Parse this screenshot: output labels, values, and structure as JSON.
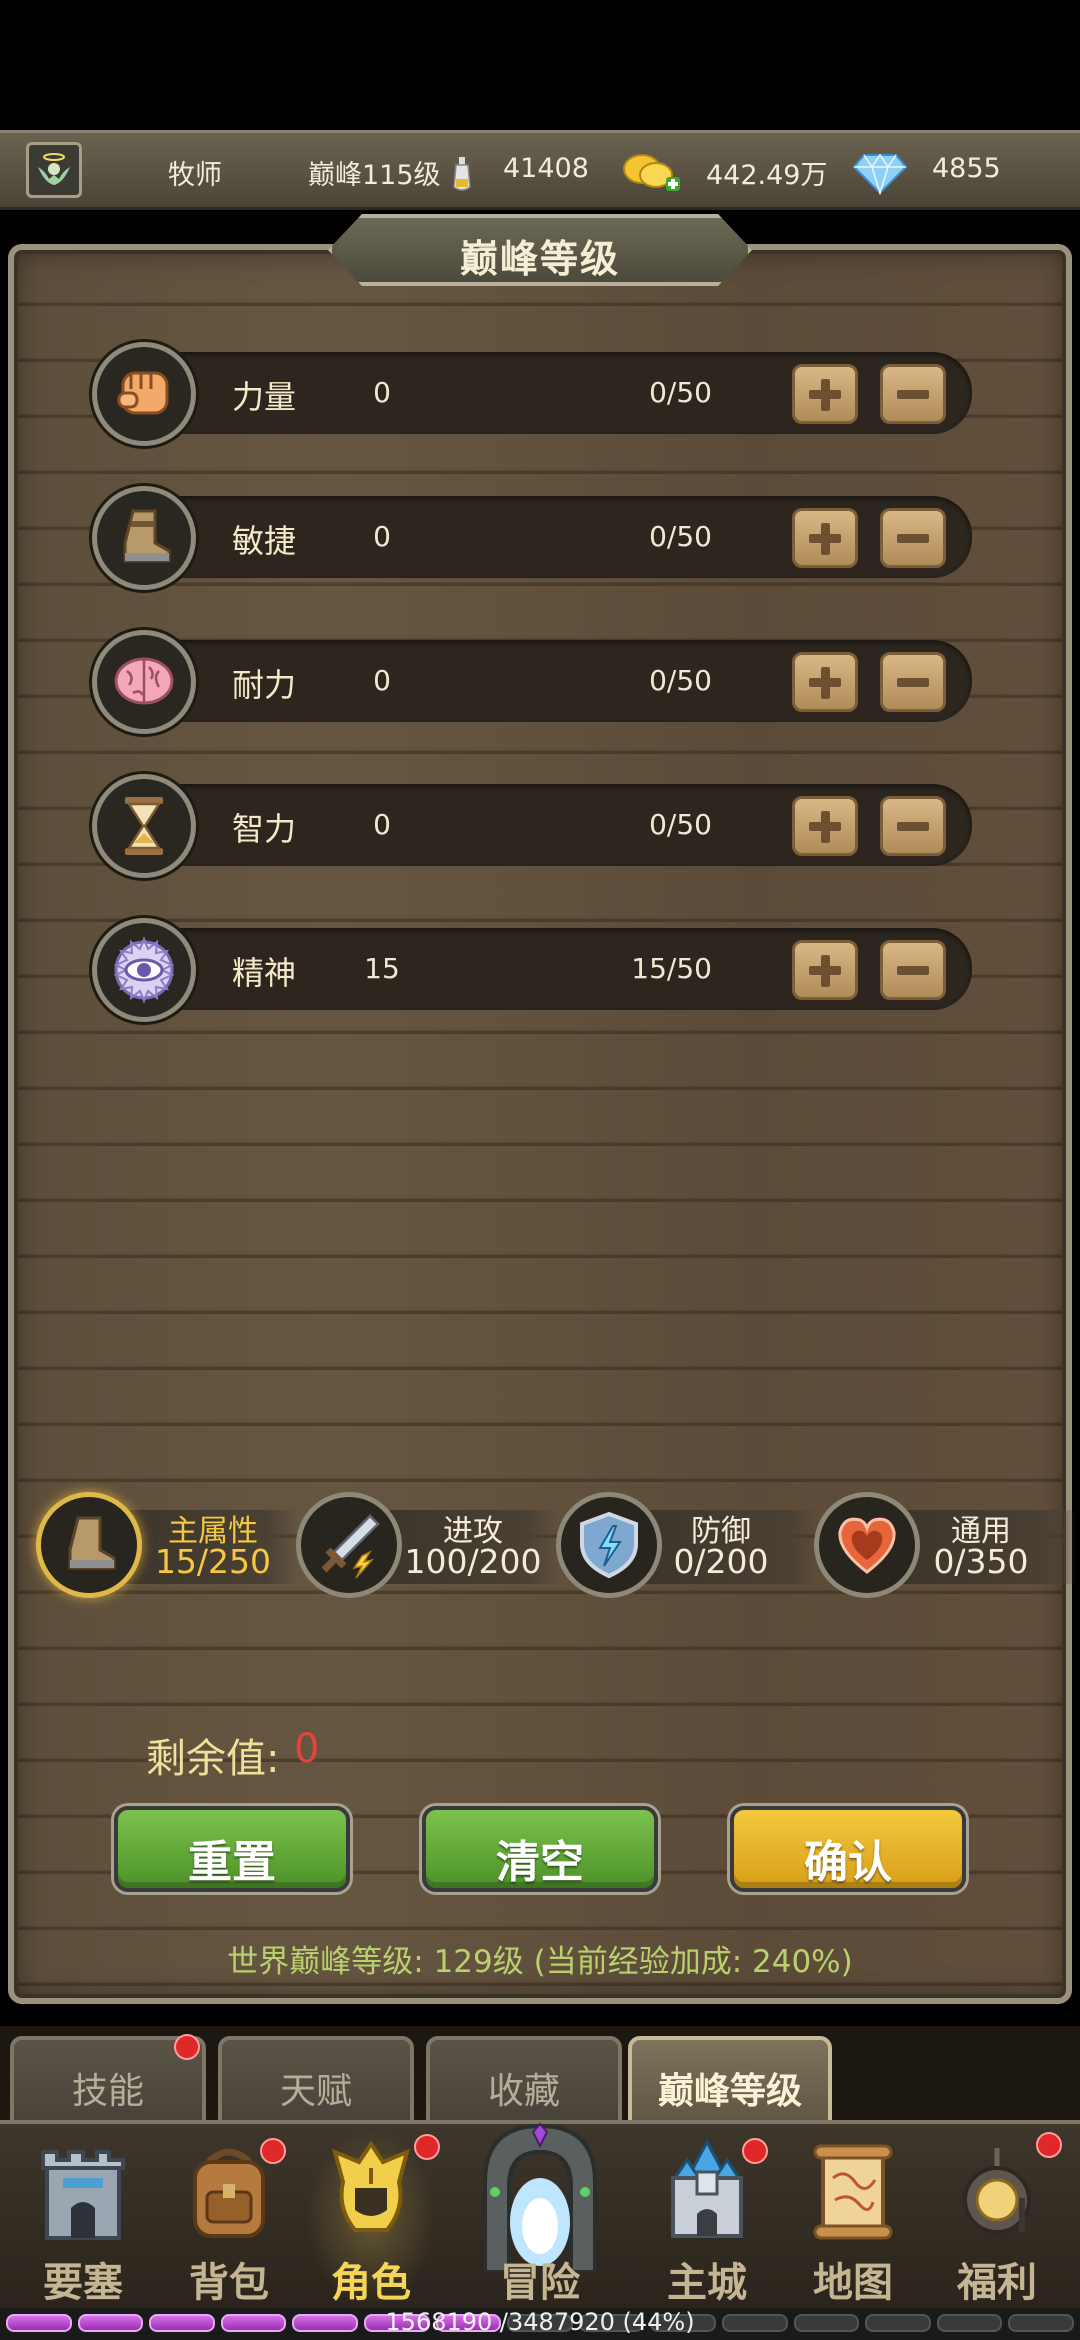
{
  "topbar": {
    "class_name": "牧师",
    "peak_level": "巅峰115级",
    "exp": "41408",
    "gold": "442.49万",
    "gems": "4855"
  },
  "panel": {
    "title": "巅峰等级"
  },
  "stats": [
    {
      "name": "力量",
      "value": "0",
      "cap": "0/50",
      "icon": "fist-icon"
    },
    {
      "name": "敏捷",
      "value": "0",
      "cap": "0/50",
      "icon": "boot-icon"
    },
    {
      "name": "耐力",
      "value": "0",
      "cap": "0/50",
      "icon": "brain-icon"
    },
    {
      "name": "智力",
      "value": "0",
      "cap": "0/50",
      "icon": "hourglass-icon"
    },
    {
      "name": "精神",
      "value": "15",
      "cap": "15/50",
      "icon": "eye-icon"
    }
  ],
  "categories": [
    {
      "label": "主属性",
      "value": "15/250",
      "active": true
    },
    {
      "label": "进攻",
      "value": "100/200",
      "active": false
    },
    {
      "label": "防御",
      "value": "0/200",
      "active": false
    },
    {
      "label": "通用",
      "value": "0/350",
      "active": false
    }
  ],
  "remaining": {
    "label": "剩余值:",
    "value": "0"
  },
  "buttons": {
    "reset": "重置",
    "clear": "清空",
    "confirm": "确认"
  },
  "world_peak": "世界巅峰等级: 129级 (当前经验加成: 240%)",
  "subtabs": [
    {
      "label": "技能",
      "badge": true
    },
    {
      "label": "天赋",
      "badge": false
    },
    {
      "label": "收藏",
      "badge": false
    },
    {
      "label": "巅峰等级",
      "badge": false,
      "active": true
    }
  ],
  "nav": [
    {
      "label": "要塞",
      "badge": false
    },
    {
      "label": "背包",
      "badge": true
    },
    {
      "label": "角色",
      "badge": true,
      "active": true
    },
    {
      "label": "冒险",
      "badge": false
    },
    {
      "label": "主城",
      "badge": true
    },
    {
      "label": "地图",
      "badge": false
    },
    {
      "label": "福利",
      "badge": true
    }
  ],
  "exp_bar": {
    "text": "1568190 /3487920 (44%)",
    "progress": 0.44
  },
  "colors": {
    "accent_gold": "#f4c840",
    "remain_red": "#e7433e",
    "green_button": "#5ba832",
    "yellow_button": "#e7b528",
    "world_text": "#b9d16c"
  }
}
